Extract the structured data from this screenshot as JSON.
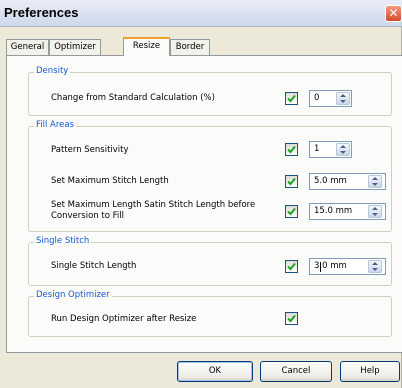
{
  "window": {
    "title": "Preferences",
    "close_glyph": "✕"
  },
  "tabs": [
    {
      "label": "General",
      "active": false
    },
    {
      "label": "Optimizer",
      "active": false
    },
    {
      "label": "Resize",
      "active": true
    },
    {
      "label": "Border",
      "active": false
    }
  ],
  "groups": {
    "density": {
      "title": "Density",
      "rows": [
        {
          "label": "Change from Standard Calculation (%)",
          "checked": true,
          "value": "0"
        }
      ]
    },
    "fill_areas": {
      "title": "Fill Areas",
      "rows": [
        {
          "label": "Pattern Sensitivity",
          "checked": true,
          "value": "1"
        },
        {
          "label": "Set Maximum Stitch Length",
          "checked": true,
          "value": "5.0 mm"
        },
        {
          "label": "Set Maximum Length Satin Stitch Length before Conversion to Fill",
          "checked": true,
          "value": "15.0 mm"
        }
      ]
    },
    "single_stitch": {
      "title": "Single Stitch",
      "rows": [
        {
          "label": "Single Stitch Length",
          "checked": true,
          "value": "3.0 mm"
        }
      ]
    },
    "design_optimizer": {
      "title": "Design Optimizer",
      "rows": [
        {
          "label": "Run Design Optimizer after Resize",
          "checked": true
        }
      ]
    }
  },
  "buttons": {
    "ok": "OK",
    "cancel": "Cancel",
    "help": "Help"
  },
  "colors": {
    "accent": "#1559d4",
    "tab_highlight": "#f0a22c",
    "check": "#21a121"
  }
}
